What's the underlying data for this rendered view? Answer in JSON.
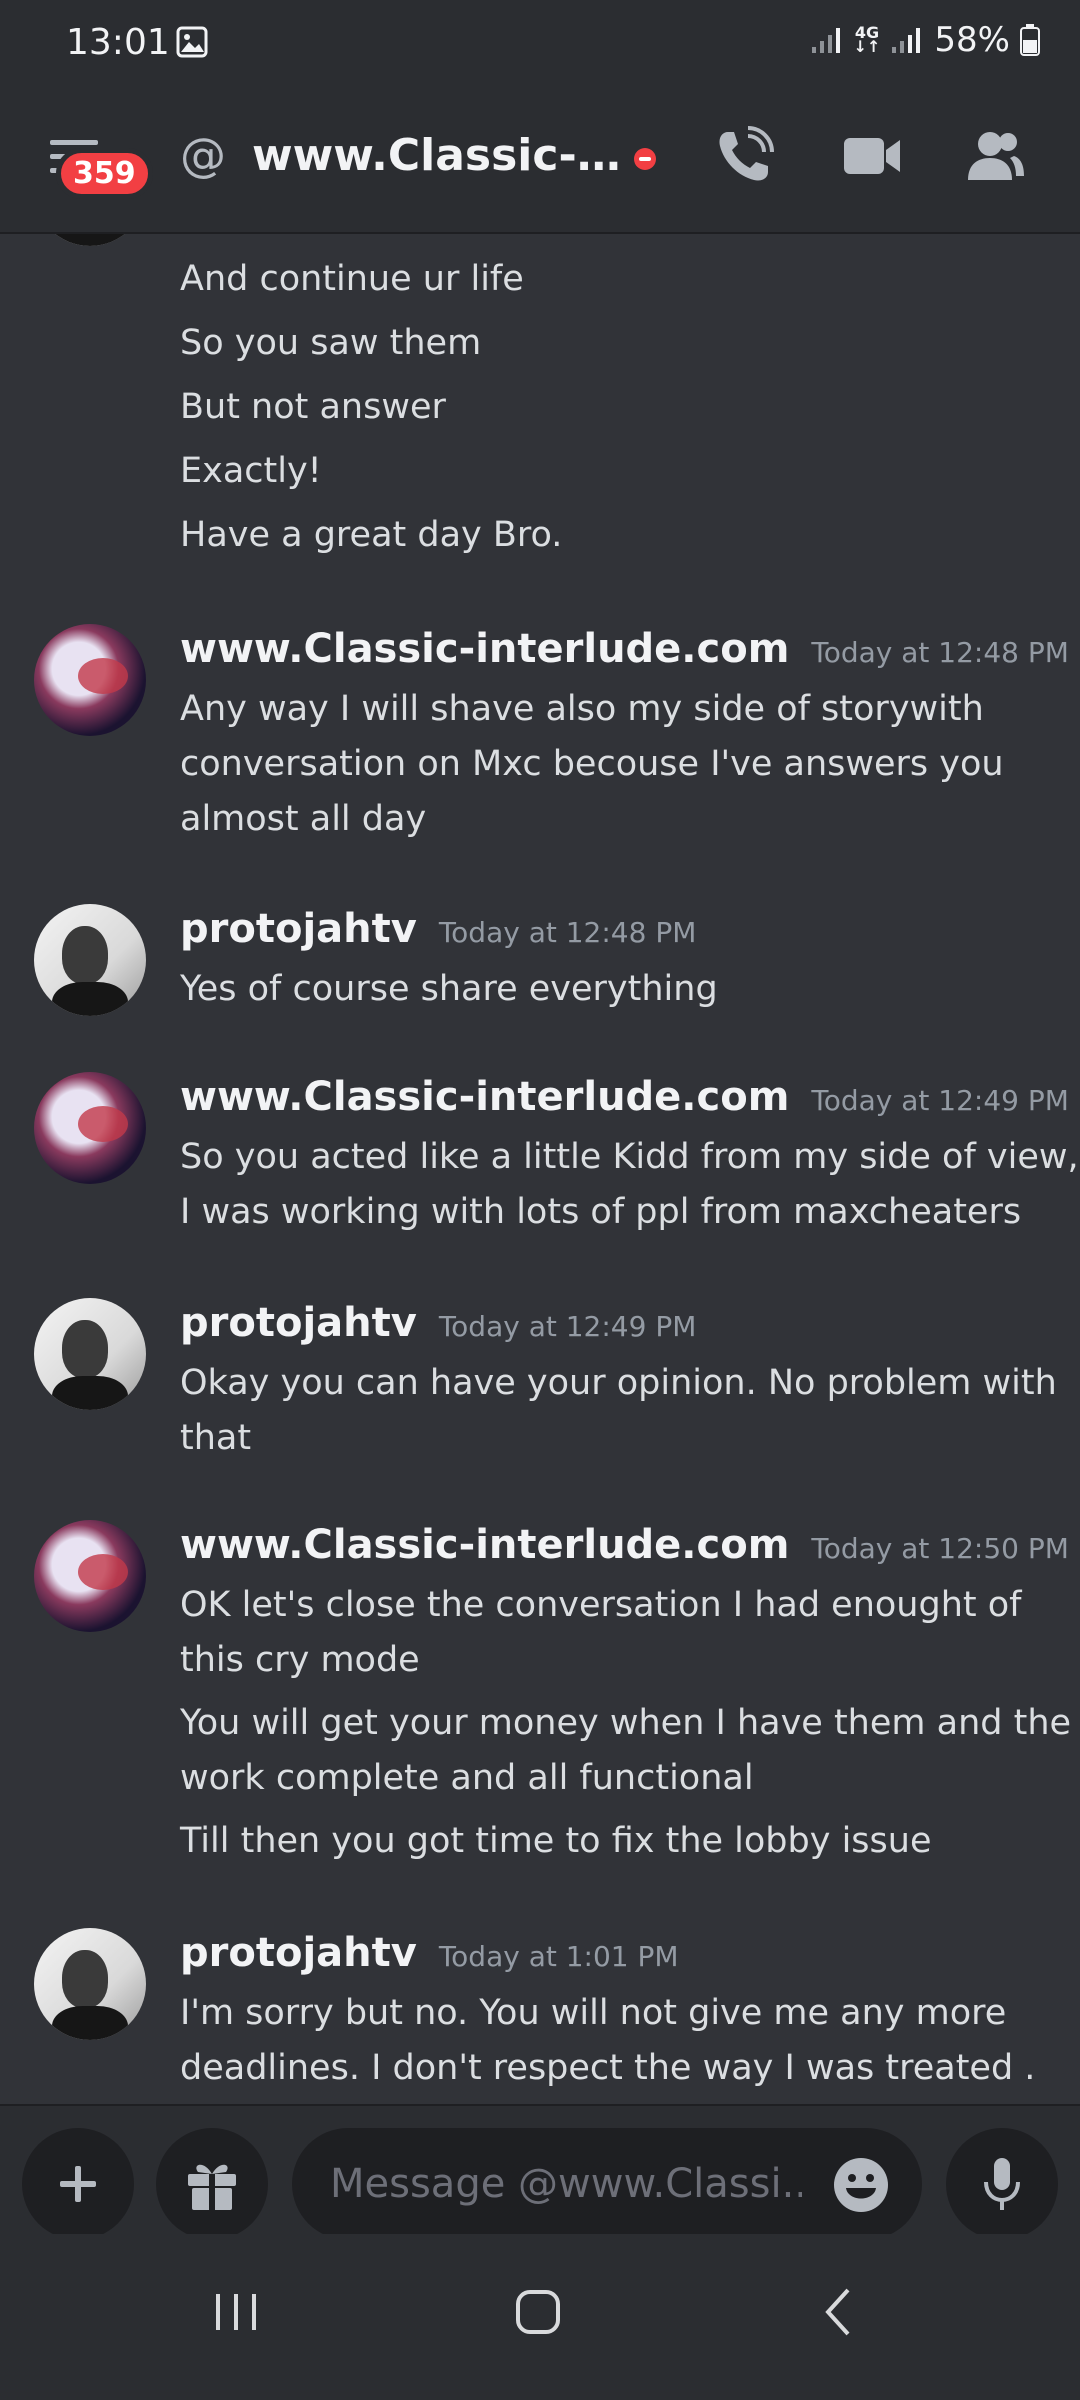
{
  "status_bar": {
    "time": "13:01",
    "network": "4G",
    "battery": "58%"
  },
  "header": {
    "unread_count": "359",
    "at_symbol": "@",
    "title": "www.Classic-int..."
  },
  "messages": {
    "continued_lines": [
      "And continue ur life",
      "So you saw them",
      "But not answer",
      "Exactly!",
      "Have a great day Bro."
    ],
    "groups": [
      {
        "author": "www.Classic-interlude.com",
        "timestamp": "Today at 12:48 PM",
        "lines": [
          "Any way I will shave also my side of storywith",
          "conversation on Mxc becouse I've answers you",
          "almost all day"
        ]
      },
      {
        "author": "protojahtv",
        "timestamp": "Today at 12:48 PM",
        "lines": [
          "Yes of course share everything"
        ]
      },
      {
        "author": "www.Classic-interlude.com",
        "timestamp": "Today at 12:49 PM",
        "lines": [
          "So you acted like a little Kidd from my side of view,",
          "I was working with lots of ppl from maxcheaters"
        ]
      },
      {
        "author": "protojahtv",
        "timestamp": "Today at 12:49 PM",
        "lines": [
          "Okay you can have your opinion.  No problem with",
          "that"
        ]
      },
      {
        "author": "www.Classic-interlude.com",
        "timestamp": "Today at 12:50 PM",
        "lines": [
          "OK let's close the conversation I had enought of",
          "this cry mode",
          "You will get your money when I have them and  the",
          "work complete and all functional",
          "Till then you got time to fix the lobby issue"
        ]
      },
      {
        "author": "protojahtv",
        "timestamp": "Today at 1:01 PM",
        "lines": [
          "I'm sorry but no. You will not give me any more",
          "deadlines.  I don't respect the way I was treated ."
        ]
      }
    ]
  },
  "composer": {
    "placeholder": "Message @www.Classi...",
    "value": ""
  },
  "colors": {
    "background": "#313338",
    "bar": "#2b2d31",
    "input": "#1e1f22",
    "accent_red": "#f23f43"
  },
  "icons": [
    "image-icon",
    "signal-icon",
    "battery-icon",
    "menu-icon",
    "at-icon",
    "dnd-status-icon",
    "call-icon",
    "video-icon",
    "members-icon",
    "plus-icon",
    "gift-icon",
    "emoji-icon",
    "mic-icon",
    "recent-apps-icon",
    "home-icon",
    "back-icon"
  ]
}
